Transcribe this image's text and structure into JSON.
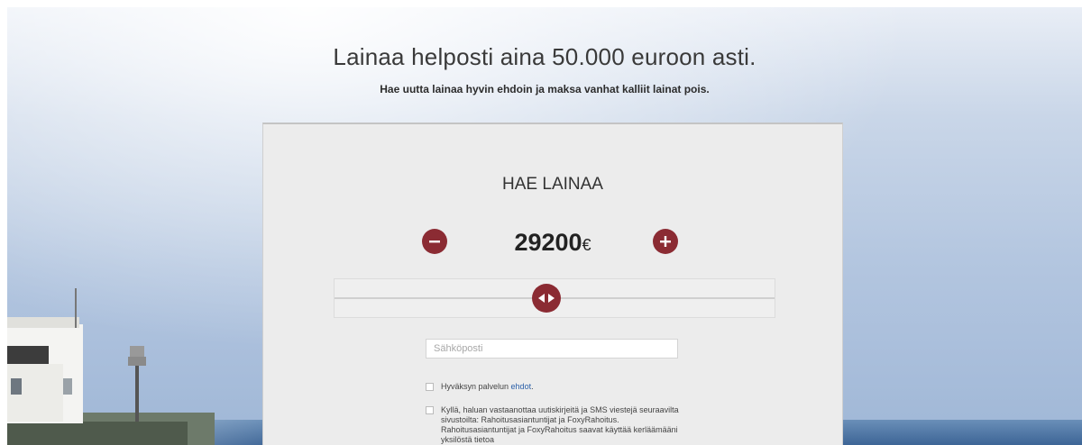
{
  "hero": {
    "headline": "Lainaa helposti aina 50.000 euroon asti.",
    "subhead": "Hae uutta lainaa hyvin ehdoin ja maksa vanhat kalliit lainat pois."
  },
  "form": {
    "title": "HAE LAINAA",
    "amount": "29200",
    "currency": "€",
    "slider_level": 0.48,
    "email_placeholder": "Sähköposti",
    "terms_prefix": "Hyväksyn palvelun ",
    "terms_link": "ehdot",
    "terms_suffix": ".",
    "marketing_text": "Kyllä, haluan vastaanottaa uutiskirjeitä ja SMS viestejä seuraavilta sivustoilta: Rahoitusasiantuntijat ja FoxyRahoitus. Rahoitusasiantuntijat ja FoxyRahoitus saavat käyttää kerläämääni yksilöstä tietoa"
  },
  "colors": {
    "accent": "#8b2b33",
    "link": "#2a5fa8"
  },
  "icons": {
    "minus": "minus-icon",
    "plus": "plus-icon",
    "slider": "arrows-left-right-icon"
  }
}
